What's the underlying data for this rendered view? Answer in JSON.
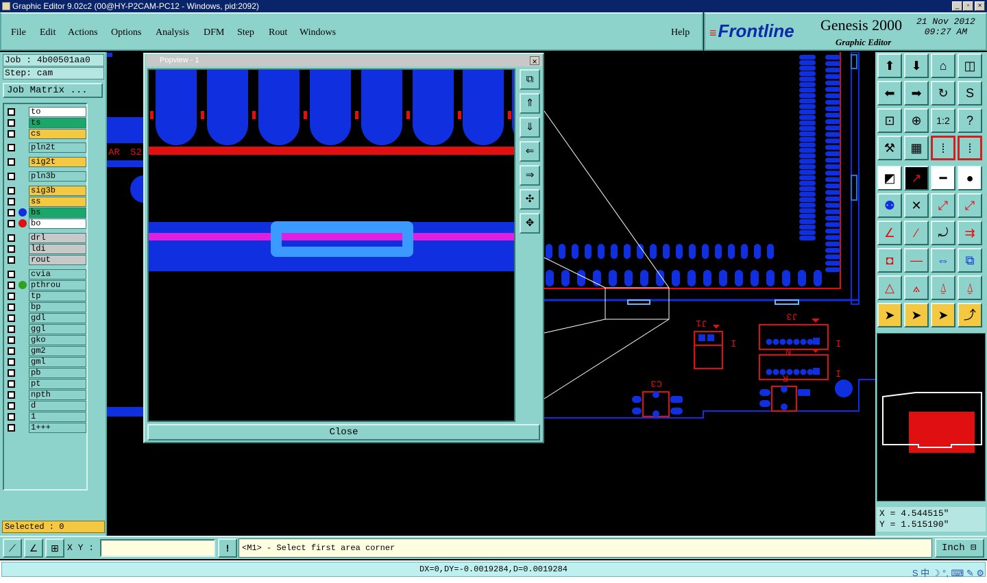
{
  "window": {
    "title": "Graphic Editor 9.02c2 (00@HY-P2CAM-PC12 - Windows, pid:2092)",
    "buttons": [
      "_",
      "▫",
      "×"
    ]
  },
  "menu": {
    "items": [
      "File",
      "Edit",
      "Actions",
      "Options",
      "Analysis",
      "DFM",
      "Step",
      "Rout",
      "Windows"
    ],
    "help": "Help"
  },
  "brand": {
    "logo": "Frontline",
    "product": "Genesis 2000",
    "subtitle": "Graphic Editor",
    "date": "21 Nov 2012",
    "time": "09:27 AM"
  },
  "job": {
    "job_label": "Job : 4b00501aa0",
    "step_label": "Step: cam",
    "matrix_button": "Job Matrix ..."
  },
  "layers": [
    {
      "name": "to",
      "color": "#ffffff",
      "dot": ""
    },
    {
      "name": "ts",
      "color": "#1aa86a",
      "dot": ""
    },
    {
      "name": "cs",
      "color": "#f5c842",
      "dot": ""
    },
    {
      "name": "pln2t",
      "color": "#8ed2cc",
      "dot": ""
    },
    {
      "name": "sig2t",
      "color": "#f5c842",
      "dot": ""
    },
    {
      "name": "pln3b",
      "color": "#8ed2cc",
      "dot": ""
    },
    {
      "name": "sig3b",
      "color": "#f5c842",
      "dot": ""
    },
    {
      "name": "ss",
      "color": "#f5c842",
      "dot": ""
    },
    {
      "name": "bs",
      "color": "#1aa86a",
      "dot": "#1030e0"
    },
    {
      "name": "bo",
      "color": "#ffffff",
      "dot": "#e01010"
    },
    {
      "name": "drl",
      "color": "#c8c8c8",
      "dot": ""
    },
    {
      "name": "ldi",
      "color": "#c8c8c8",
      "dot": ""
    },
    {
      "name": "rout",
      "color": "#c8c8c8",
      "dot": ""
    },
    {
      "name": "cvia",
      "color": "#8ed2cc",
      "dot": ""
    },
    {
      "name": "pthrou",
      "color": "#8ed2cc",
      "dot": "#30a020"
    },
    {
      "name": "tp",
      "color": "#8ed2cc",
      "dot": ""
    },
    {
      "name": "bp",
      "color": "#8ed2cc",
      "dot": ""
    },
    {
      "name": "gdl",
      "color": "#8ed2cc",
      "dot": ""
    },
    {
      "name": "ggl",
      "color": "#8ed2cc",
      "dot": ""
    },
    {
      "name": "gko",
      "color": "#8ed2cc",
      "dot": ""
    },
    {
      "name": "gm2",
      "color": "#8ed2cc",
      "dot": ""
    },
    {
      "name": "gml",
      "color": "#8ed2cc",
      "dot": ""
    },
    {
      "name": "pb",
      "color": "#8ed2cc",
      "dot": ""
    },
    {
      "name": "pt",
      "color": "#8ed2cc",
      "dot": ""
    },
    {
      "name": "npth",
      "color": "#8ed2cc",
      "dot": ""
    },
    {
      "name": "d",
      "color": "#8ed2cc",
      "dot": ""
    },
    {
      "name": "1",
      "color": "#8ed2cc",
      "dot": ""
    },
    {
      "name": "1+++",
      "color": "#8ed2cc",
      "dot": ""
    }
  ],
  "selected_label": "Selected : 0",
  "popview": {
    "title": "Popview - 1",
    "close_button": "Close"
  },
  "board_labels": {
    "j1": "J1",
    "j3": "J3",
    "c3": "C3",
    "r": "R",
    "n": "N",
    "ar": "AR",
    "s2": "S2"
  },
  "coords": {
    "x": "X = 4.544515\"",
    "y": "Y = 1.515190\""
  },
  "bottom": {
    "xy_label": "X Y :",
    "xy_value": "",
    "warn": "!",
    "prompt": "<M1> - Select first area corner",
    "units": "Inch"
  },
  "status": "DX=0,DY=-0.0019284,D=0.0019284",
  "tray": "S 中 ☽ °, ⌨ ✎ ⚙"
}
